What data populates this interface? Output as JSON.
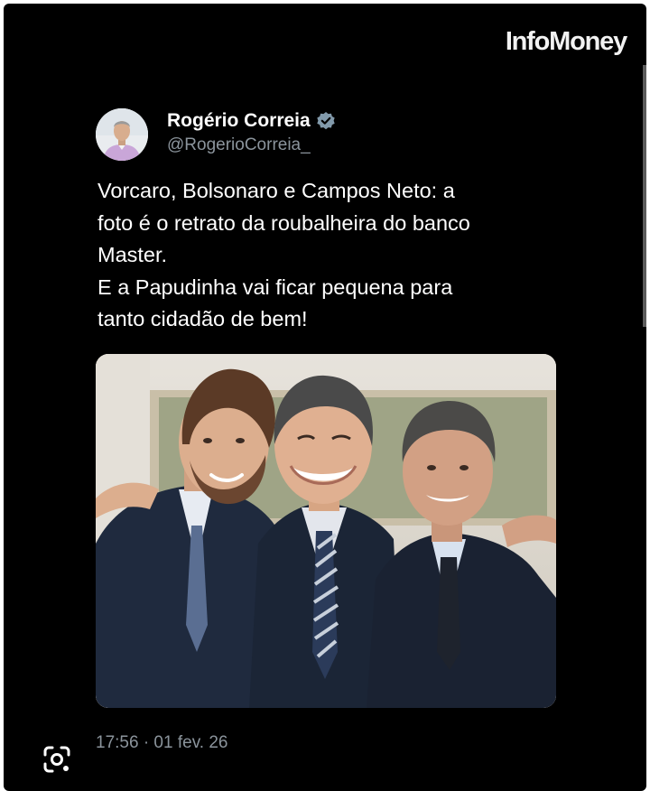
{
  "brand": {
    "logo_text": "InfoMoney"
  },
  "tweet": {
    "author_name": "Rogério Correia",
    "handle": "@RogerioCorreia_",
    "text_lines": [
      "Vorcaro, Bolsonaro e Campos Neto: a",
      "foto é o retrato da roubalheira do banco",
      "Master.",
      "E a Papudinha vai ficar pequena para",
      "tanto cidadão de bem!"
    ],
    "timestamp": "17:56 · 01 fev. 26"
  },
  "icons": {
    "verified": "verified-badge-icon",
    "lens": "google-lens-icon"
  },
  "colors": {
    "background": "#000000",
    "text_primary": "#ffffff",
    "text_secondary": "#8b949c",
    "verified_badge": "#829aab"
  }
}
